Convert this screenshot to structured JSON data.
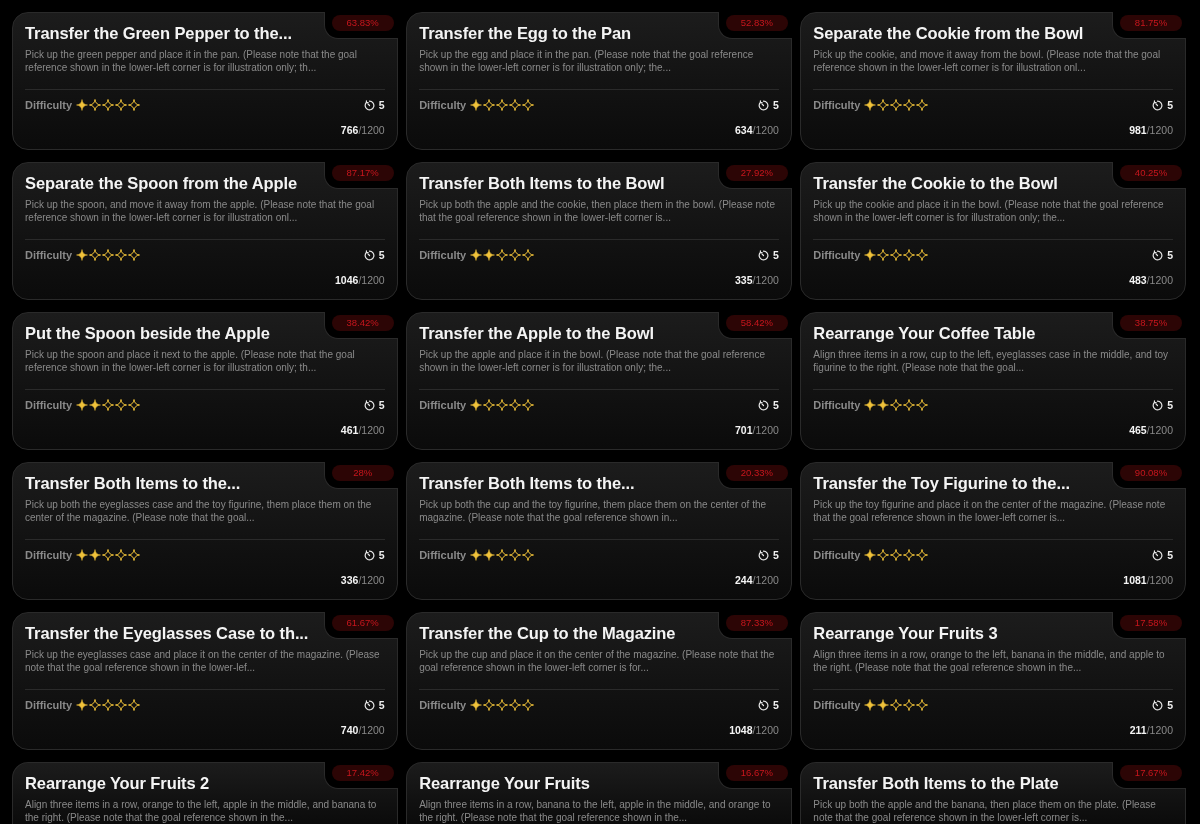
{
  "tasks": [
    {
      "title": "Transfer the Green Pepper to the...",
      "success_rate": "63.83%",
      "description": "Pick up the green pepper and place it in the pan. (Please note that the goal reference shown in the lower-left corner is for illustration only; th...",
      "difficulty_label": "Difficulty",
      "stars": 1,
      "time_limit": "5",
      "attempts": "**766**/1200"
    },
    {
      "title": "Transfer the Egg to the Pan",
      "success_rate": "52.83%",
      "description": "Pick up the egg and place it in the pan. (Please note that the goal reference shown in the lower-left corner is for illustration only; the...",
      "difficulty_label": "Difficulty",
      "stars": 1,
      "time_limit": "5",
      "attempts": "**634**/1200"
    },
    {
      "title": "Separate the Cookie from the Bowl",
      "success_rate": "81.75%",
      "description": "Pick up the cookie, and move it away from the bowl. (Please note that the goal reference shown in the lower-left corner is for illustration onl...",
      "difficulty_label": "Difficulty",
      "stars": 1,
      "time_limit": "5",
      "attempts": "**981**/1200"
    },
    {
      "title": "Separate the Spoon from the Apple",
      "success_rate": "87.17%",
      "description": "Pick up the spoon, and move it away from the apple. (Please note that the goal reference shown in the lower-left corner is for illustration onl...",
      "difficulty_label": "Difficulty",
      "stars": 1,
      "time_limit": "5",
      "attempts": "**1046**/1200"
    },
    {
      "title": "Transfer Both Items to the Bowl",
      "success_rate": "27.92%",
      "description": "Pick up both the apple and the cookie, then place them in the bowl. (Please note that the goal reference shown in the lower-left corner is...",
      "difficulty_label": "Difficulty",
      "stars": 2,
      "time_limit": "5",
      "attempts": "**335**/1200"
    },
    {
      "title": "Transfer the Cookie to the Bowl",
      "success_rate": "40.25%",
      "description": "Pick up the cookie and place it in the bowl. (Please note that the goal reference shown in the lower-left corner is for illustration only; the...",
      "difficulty_label": "Difficulty",
      "stars": 1,
      "time_limit": "5",
      "attempts": "**483**/1200"
    },
    {
      "title": "Put the Spoon beside the Apple",
      "success_rate": "38.42%",
      "description": "Pick up the spoon and place it next to the apple. (Please note that the goal reference shown in the lower-left corner is for illustration only; th...",
      "difficulty_label": "Difficulty",
      "stars": 2,
      "time_limit": "5",
      "attempts": "**461**/1200"
    },
    {
      "title": "Transfer the Apple to the Bowl",
      "success_rate": "58.42%",
      "description": "Pick up the apple and place it in the bowl. (Please note that the goal reference shown in the lower-left corner is for illustration only; the...",
      "difficulty_label": "Difficulty",
      "stars": 1,
      "time_limit": "5",
      "attempts": "**701**/1200"
    },
    {
      "title": "Rearrange Your Coffee Table",
      "success_rate": "38.75%",
      "description": "Align three items in a row, cup to the left, eyeglasses case in the middle, and toy figurine to the right. (Please note that the goal...",
      "difficulty_label": "Difficulty",
      "stars": 2,
      "time_limit": "5",
      "attempts": "**465**/1200"
    },
    {
      "title": "Transfer Both Items to the...",
      "success_rate": "28%",
      "description": "Pick up both the eyeglasses case and the toy figurine, them place them on the center of the magazine. (Please note that the goal...",
      "difficulty_label": "Difficulty",
      "stars": 2,
      "time_limit": "5",
      "attempts": "**336**/1200"
    },
    {
      "title": "Transfer Both Items to the...",
      "success_rate": "20.33%",
      "description": "Pick up both the cup and the toy figurine, them place them on the center of the magazine. (Please note that the goal reference shown in...",
      "difficulty_label": "Difficulty",
      "stars": 2,
      "time_limit": "5",
      "attempts": "**244**/1200"
    },
    {
      "title": "Transfer the Toy Figurine to the...",
      "success_rate": "90.08%",
      "description": "Pick up the toy figurine and place it on the center of the magazine. (Please note that the goal reference shown in the lower-left corner is...",
      "difficulty_label": "Difficulty",
      "stars": 1,
      "time_limit": "5",
      "attempts": "**1081**/1200"
    },
    {
      "title": "Transfer the Eyeglasses Case to th...",
      "success_rate": "61.67%",
      "description": "Pick up the eyeglasses case and place it on the center of the magazine. (Please note that the goal reference shown in the lower-lef...",
      "difficulty_label": "Difficulty",
      "stars": 1,
      "time_limit": "5",
      "attempts": "**740**/1200"
    },
    {
      "title": "Transfer the Cup to the Magazine",
      "success_rate": "87.33%",
      "description": "Pick up the cup and place it on the center of the magazine. (Please note that the goal reference shown in the lower-left corner is for...",
      "difficulty_label": "Difficulty",
      "stars": 1,
      "time_limit": "5",
      "attempts": "**1048**/1200"
    },
    {
      "title": "Rearrange Your Fruits 3",
      "success_rate": "17.58%",
      "description": "Align three items in a row, orange to the left, banana in the middle, and apple to the right. (Please note that the goal reference shown in the...",
      "difficulty_label": "Difficulty",
      "stars": 2,
      "time_limit": "5",
      "attempts": "**211**/1200"
    },
    {
      "title": "Rearrange Your Fruits 2",
      "success_rate": "17.42%",
      "description": "Align three items in a row, orange to the left, apple in the middle, and banana to the right. (Please note that the goal reference shown in the..."
    },
    {
      "title": "Rearrange Your Fruits",
      "success_rate": "16.67%",
      "description": "Align three items in a row, banana to the left, apple in the middle, and orange to the right. (Please note that the goal reference shown in the..."
    },
    {
      "title": "Transfer Both Items to the Plate",
      "success_rate": "17.67%",
      "description": "Pick up both the apple and the banana, then place them on the plate. (Please note that the goal reference shown in the lower-left corner is..."
    }
  ]
}
